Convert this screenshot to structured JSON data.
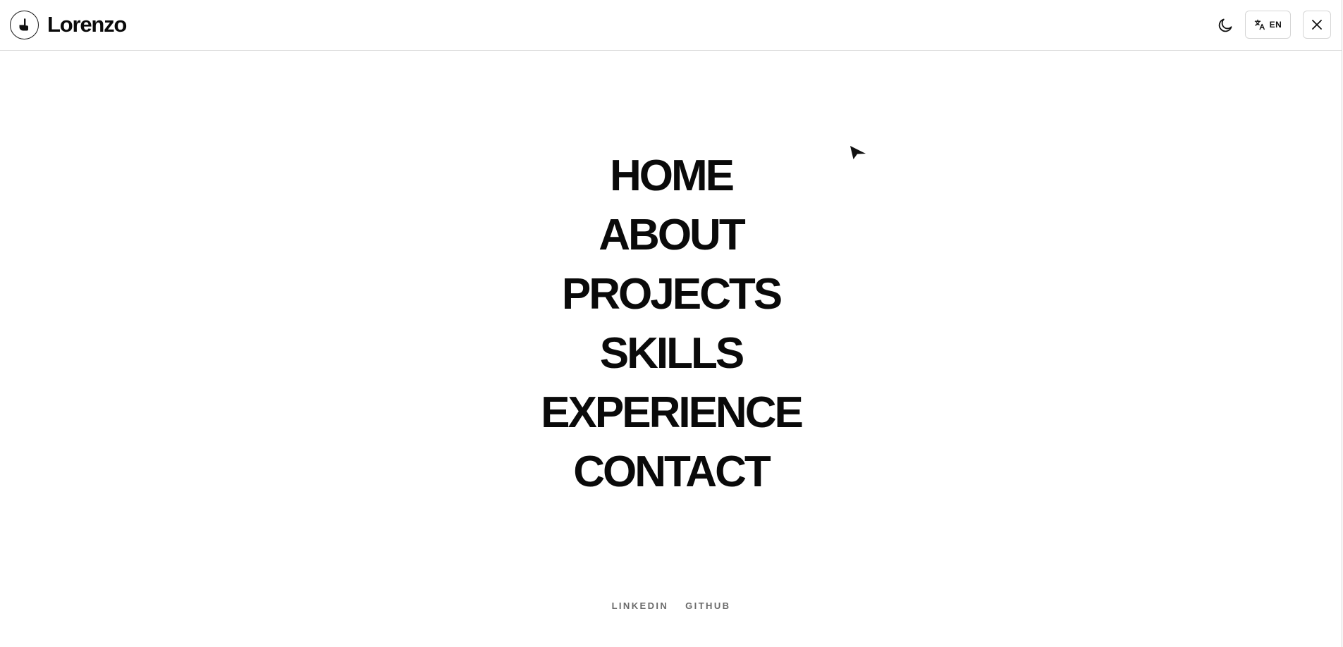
{
  "header": {
    "brand": "Lorenzo",
    "logo_icon": "hand-pointer-icon",
    "theme_icon": "moon-icon",
    "language": {
      "icon": "translate-icon",
      "code": "EN"
    },
    "close_icon": "close-icon"
  },
  "menu": {
    "items": [
      {
        "label": "HOME"
      },
      {
        "label": "ABOUT"
      },
      {
        "label": "PROJECTS"
      },
      {
        "label": "SKILLS"
      },
      {
        "label": "EXPERIENCE"
      },
      {
        "label": "CONTACT"
      }
    ]
  },
  "footer": {
    "links": [
      {
        "label": "LINKEDIN"
      },
      {
        "label": "GITHUB"
      }
    ]
  },
  "colors": {
    "text": "#0a0a0a",
    "muted": "#6b6b6b",
    "border": "#d6d6d6",
    "background": "#ffffff"
  }
}
